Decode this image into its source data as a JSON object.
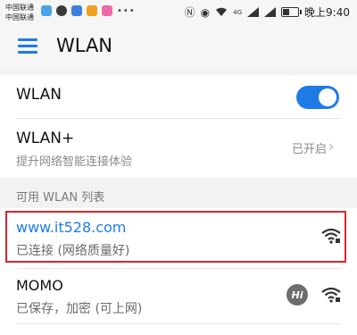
{
  "status_bar": {
    "carrier_1": "中国联通",
    "carrier_2": "中国联通",
    "dots": "•••",
    "signal_label": "4G",
    "time": "晚上9:40"
  },
  "header": {
    "title": "WLAN"
  },
  "settings": {
    "wlan_toggle": {
      "label": "WLAN",
      "enabled": true
    },
    "wlan_plus": {
      "label": "WLAN+",
      "subtitle": "提升网络智能连接体验",
      "status": "已开启"
    }
  },
  "network_list": {
    "section_title": "可用 WLAN 列表",
    "networks": [
      {
        "name": "www.it528.com",
        "status": "已连接 (网络质量好)",
        "connected": true,
        "secured": true
      },
      {
        "name": "MOMO",
        "status": "已保存，加密 (可上网)",
        "connected": false,
        "secured": true,
        "badge": "Hi"
      }
    ]
  },
  "colors": {
    "accent": "#1e7be6",
    "highlight_border": "#d8262e",
    "background": "#f2f2f2"
  }
}
